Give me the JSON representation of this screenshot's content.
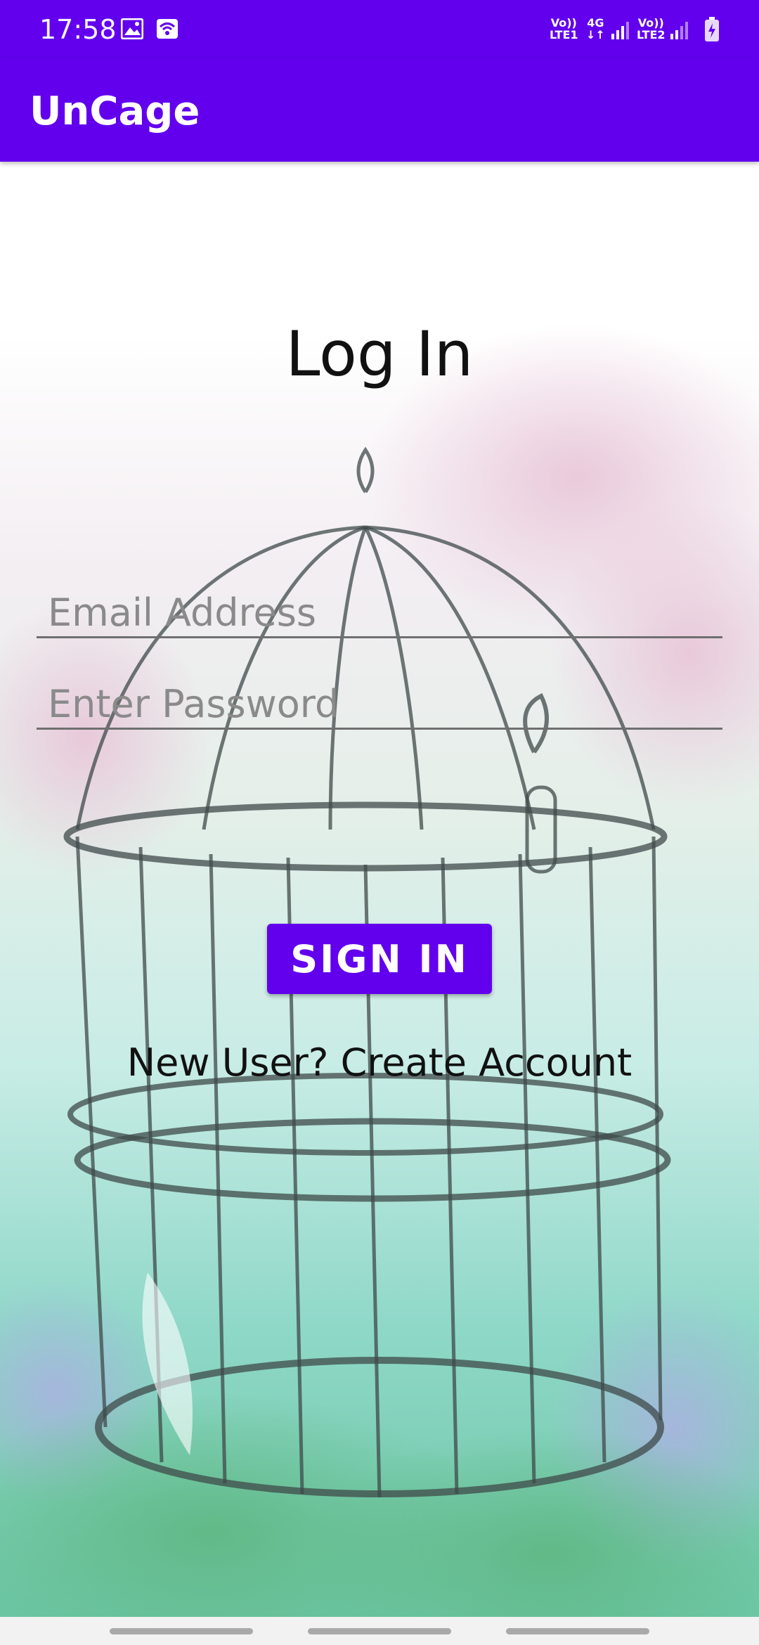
{
  "status_bar": {
    "time": "17:58",
    "icons": [
      "image-icon",
      "wifi-icon"
    ],
    "sim1": {
      "top": "Vo))",
      "bottom": "LTE1"
    },
    "network": {
      "top": "4G",
      "bottom": "↓↑"
    },
    "sim2": {
      "top": "Vo))",
      "bottom": "LTE2"
    },
    "battery": "charging"
  },
  "app_bar": {
    "title": "UnCage"
  },
  "form": {
    "heading": "Log In",
    "email_placeholder": "Email Address",
    "email_value": "",
    "password_placeholder": "Enter Password",
    "password_value": "",
    "sign_in_label": "SIGN IN",
    "create_account_label": "New User? Create Account"
  },
  "colors": {
    "accent": "#6200ee",
    "text": "#111111",
    "hint": "#8a8a8a"
  }
}
